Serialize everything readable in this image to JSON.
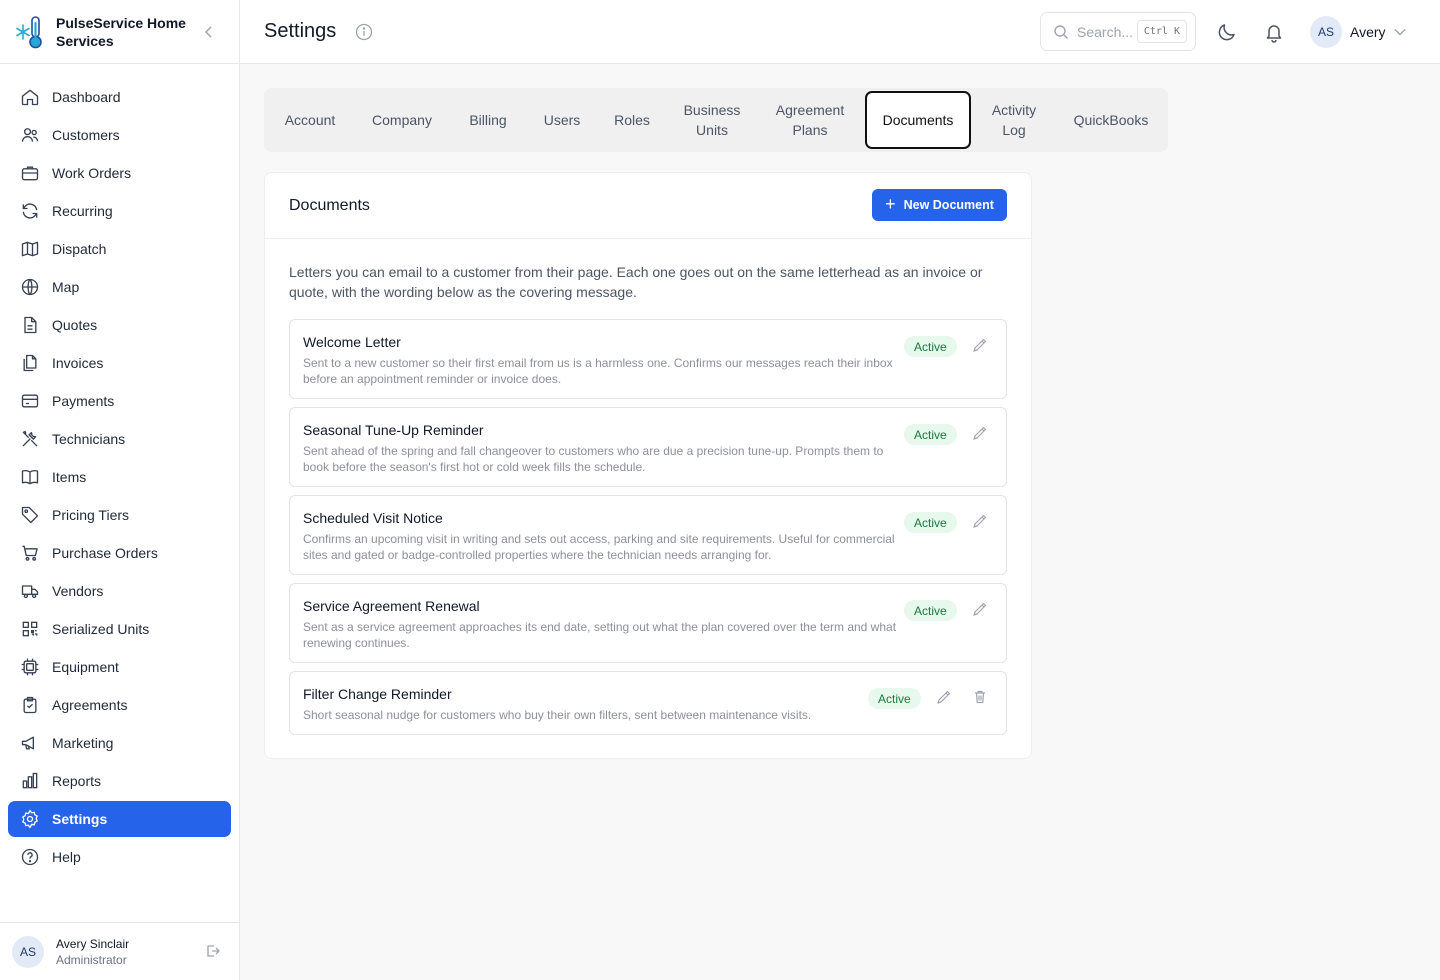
{
  "brand": {
    "name": "PulseService Home Services"
  },
  "sidebar": {
    "items": [
      {
        "label": "Dashboard",
        "icon": "home-icon"
      },
      {
        "label": "Customers",
        "icon": "users-icon"
      },
      {
        "label": "Work Orders",
        "icon": "briefcase-icon"
      },
      {
        "label": "Recurring",
        "icon": "refresh-icon"
      },
      {
        "label": "Dispatch",
        "icon": "map-fold-icon"
      },
      {
        "label": "Map",
        "icon": "globe-icon"
      },
      {
        "label": "Quotes",
        "icon": "file-icon"
      },
      {
        "label": "Invoices",
        "icon": "files-icon"
      },
      {
        "label": "Payments",
        "icon": "credit-card-icon"
      },
      {
        "label": "Technicians",
        "icon": "tools-icon"
      },
      {
        "label": "Items",
        "icon": "book-icon"
      },
      {
        "label": "Pricing Tiers",
        "icon": "tag-icon"
      },
      {
        "label": "Purchase Orders",
        "icon": "cart-icon"
      },
      {
        "label": "Vendors",
        "icon": "truck-icon"
      },
      {
        "label": "Serialized Units",
        "icon": "qr-icon"
      },
      {
        "label": "Equipment",
        "icon": "chip-icon"
      },
      {
        "label": "Agreements",
        "icon": "clipboard-icon"
      },
      {
        "label": "Marketing",
        "icon": "megaphone-icon"
      },
      {
        "label": "Reports",
        "icon": "bar-chart-icon"
      },
      {
        "label": "Settings",
        "icon": "gear-icon",
        "active": true
      },
      {
        "label": "Help",
        "icon": "help-icon"
      }
    ],
    "user": {
      "initials": "AS",
      "name": "Avery Sinclair",
      "role": "Administrator"
    }
  },
  "header": {
    "title": "Settings",
    "search_placeholder": "Search...",
    "shortcut": "Ctrl K",
    "user_initials": "AS",
    "user_name": "Avery"
  },
  "tabs": [
    {
      "label": "Account"
    },
    {
      "label": "Company"
    },
    {
      "label": "Billing"
    },
    {
      "label": "Users"
    },
    {
      "label": "Roles"
    },
    {
      "label": "Business Units"
    },
    {
      "label": "Agreement Plans"
    },
    {
      "label": "Documents",
      "active": true
    },
    {
      "label": "Activity Log"
    },
    {
      "label": "QuickBooks"
    }
  ],
  "documents_card": {
    "title": "Documents",
    "new_button": "New Document",
    "intro": "Letters you can email to a customer from their page. Each one goes out on the same letterhead as an invoice or quote, with the wording below as the covering message.",
    "items": [
      {
        "title": "Welcome Letter",
        "description": "Sent to a new customer so their first email from us is a harmless one. Confirms our messages reach their inbox before an appointment reminder or invoice does.",
        "status": "Active"
      },
      {
        "title": "Seasonal Tune-Up Reminder",
        "description": "Sent ahead of the spring and fall changeover to customers who are due a precision tune-up. Prompts them to book before the season's first hot or cold week fills the schedule.",
        "status": "Active"
      },
      {
        "title": "Scheduled Visit Notice",
        "description": "Confirms an upcoming visit in writing and sets out access, parking and site requirements. Useful for commercial sites and gated or badge-controlled properties where the technician needs arranging for.",
        "status": "Active"
      },
      {
        "title": "Service Agreement Renewal",
        "description": "Sent as a service agreement approaches its end date, setting out what the plan covered over the term and what renewing continues.",
        "status": "Active"
      },
      {
        "title": "Filter Change Reminder",
        "description": "Short seasonal nudge for customers who buy their own filters, sent between maintenance visits.",
        "status": "Active"
      }
    ]
  },
  "colors": {
    "accent": "#2563eb",
    "active_badge_bg": "#e7f8ec",
    "active_badge_text": "#1a7a3c"
  }
}
